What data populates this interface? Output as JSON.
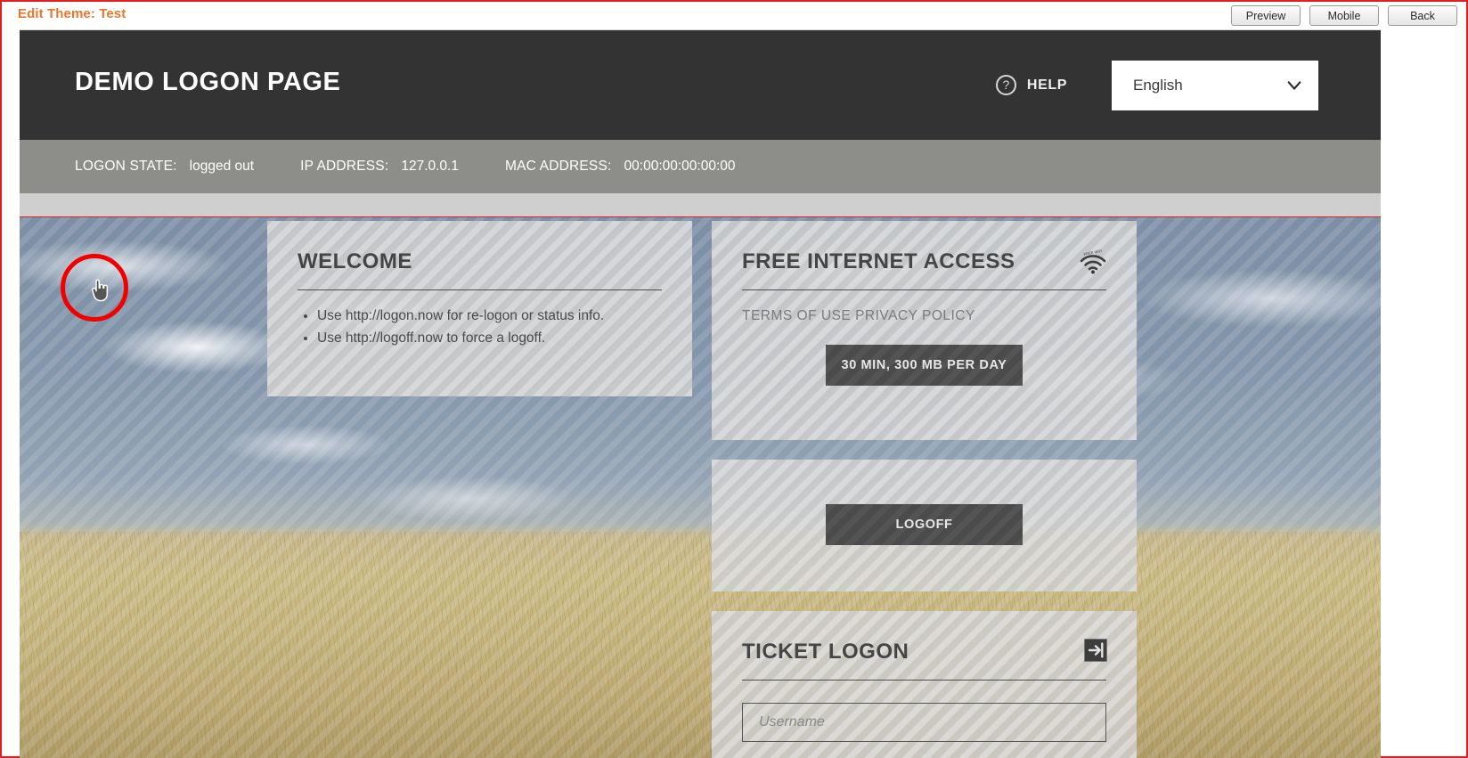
{
  "editor": {
    "title": "Edit Theme: Test",
    "buttons": [
      {
        "label": "Preview",
        "name": "preview-button"
      },
      {
        "label": "Mobile",
        "name": "mobile-button"
      },
      {
        "label": "Back",
        "name": "back-button"
      }
    ],
    "accent_color": "#e8762c",
    "frame_color": "#e02020"
  },
  "header": {
    "brand_title": "DEMO LOGON PAGE",
    "help_label": "HELP",
    "help_icon": "question-circle-icon",
    "language": {
      "selected": "English",
      "caret_icon": "chevron-down-icon"
    },
    "background_color": "#333333"
  },
  "status_bar": {
    "background_color": "#8d8d8a",
    "items": [
      {
        "label": "LOGON STATE:",
        "value": "logged out"
      },
      {
        "label": "IP ADDRESS:",
        "value": "127.0.0.1"
      },
      {
        "label": "MAC ADDRESS:",
        "value": "00:00:00:00:00:00"
      }
    ]
  },
  "panels": {
    "welcome": {
      "title": "WELCOME",
      "bullets": [
        "Use http://logon.now for re-logon or status info.",
        "Use http://logoff.now to force a logoff."
      ]
    },
    "free_internet": {
      "title": "FREE INTERNET ACCESS",
      "icon": "wifi-icon",
      "terms_link": "TERMS OF USE PRIVACY POLICY",
      "button_label": "30 MIN, 300 MB PER DAY"
    },
    "logoff": {
      "button_label": "LOGOFF"
    },
    "ticket_logon": {
      "title": "TICKET LOGON",
      "icon": "login-arrow-icon",
      "username_placeholder": "Username",
      "username_value": ""
    }
  },
  "annotation": {
    "cursor_ring_color": "#f20000",
    "cursor_icon": "pointing-hand-cursor-icon"
  }
}
